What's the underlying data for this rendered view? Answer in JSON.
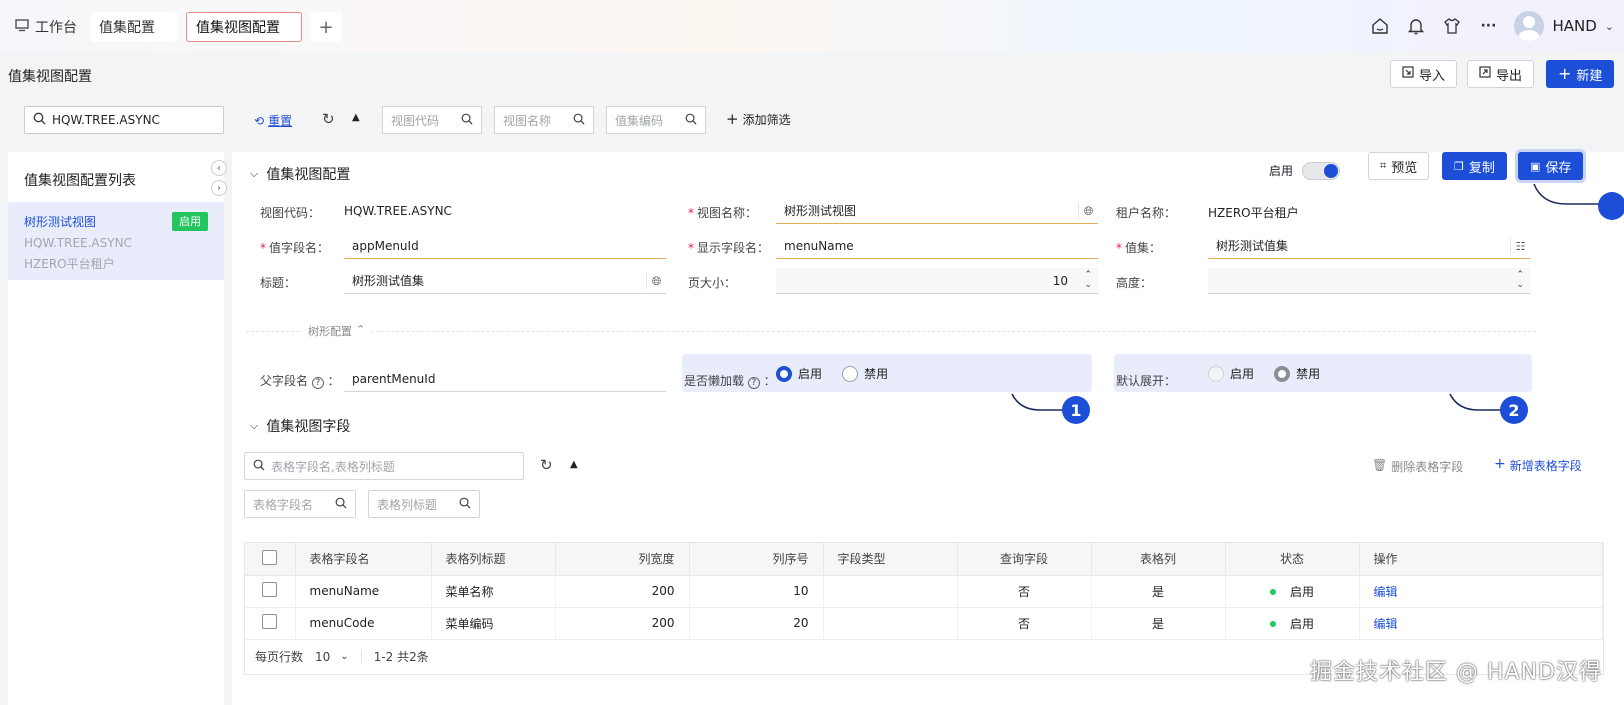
{
  "tabs": {
    "workbench": "工作台",
    "tab1": "值集配置",
    "tab2": "值集视图配置",
    "add": "+"
  },
  "user": {
    "name": "HAND"
  },
  "header": {
    "title": "值集视图配置",
    "import": "导入",
    "export": "导出",
    "new": "新建"
  },
  "filters": {
    "search_value": "HQW.TREE.ASYNC",
    "reset": "重置",
    "view_code_ph": "视图代码",
    "view_name_ph": "视图名称",
    "valueset_code_ph": "值集编码",
    "add_filter": "添加筛选"
  },
  "sidebar": {
    "title": "值集视图配置列表",
    "item": {
      "name": "树形测试视图",
      "code": "HQW.TREE.ASYNC",
      "tenant": "HZERO平台租户",
      "badge": "启用"
    }
  },
  "config": {
    "section_title": "值集视图配置",
    "enable_label": "启用",
    "preview": "预览",
    "copy": "复制",
    "save": "保存",
    "fields": {
      "view_code_label": "视图代码：",
      "view_code": "HQW.TREE.ASYNC",
      "view_name_label": "视图名称：",
      "view_name": "树形测试视图",
      "tenant_label": "租户名称：",
      "tenant": "HZERO平台租户",
      "value_field_label": "值字段名：",
      "value_field": "appMenuId",
      "display_field_label": "显示字段名：",
      "display_field": "menuName",
      "valueset_label": "值集：",
      "valueset": "树形测试值集",
      "title_label": "标题：",
      "title": "树形测试值集",
      "page_size_label": "页大小：",
      "page_size": "10",
      "height_label": "高度："
    },
    "tree": {
      "divider": "树形配置",
      "parent_field_label": "父字段名",
      "parent_field": "parentMenuId",
      "lazy_label": "是否懒加载",
      "expand_label": "默认展开：",
      "enable": "启用",
      "disable": "禁用"
    },
    "callouts": [
      "1",
      "2"
    ]
  },
  "fields_section": {
    "title": "值集视图字段",
    "search_ph": "表格字段名,表格列标题",
    "filter1_ph": "表格字段名",
    "filter2_ph": "表格列标题",
    "delete": "删除表格字段",
    "add": "新增表格字段",
    "columns": [
      "表格字段名",
      "表格列标题",
      "列宽度",
      "列序号",
      "字段类型",
      "查询字段",
      "表格列",
      "状态",
      "操作"
    ],
    "rows": [
      {
        "field": "menuName",
        "title": "菜单名称",
        "width": "200",
        "order": "10",
        "type": "",
        "query": "否",
        "column": "是",
        "status": "启用",
        "action": "编辑"
      },
      {
        "field": "menuCode",
        "title": "菜单编码",
        "width": "200",
        "order": "20",
        "type": "",
        "query": "否",
        "column": "是",
        "status": "启用",
        "action": "编辑"
      }
    ],
    "pager": {
      "rows_label": "每页行数",
      "rows_value": "10",
      "summary": "1-2  共2条"
    }
  },
  "watermark": "掘金技术社区 @ HAND汉得",
  "colors": {
    "primary": "#1d4ed8",
    "success": "#22c55e",
    "required": "#e11d48"
  }
}
